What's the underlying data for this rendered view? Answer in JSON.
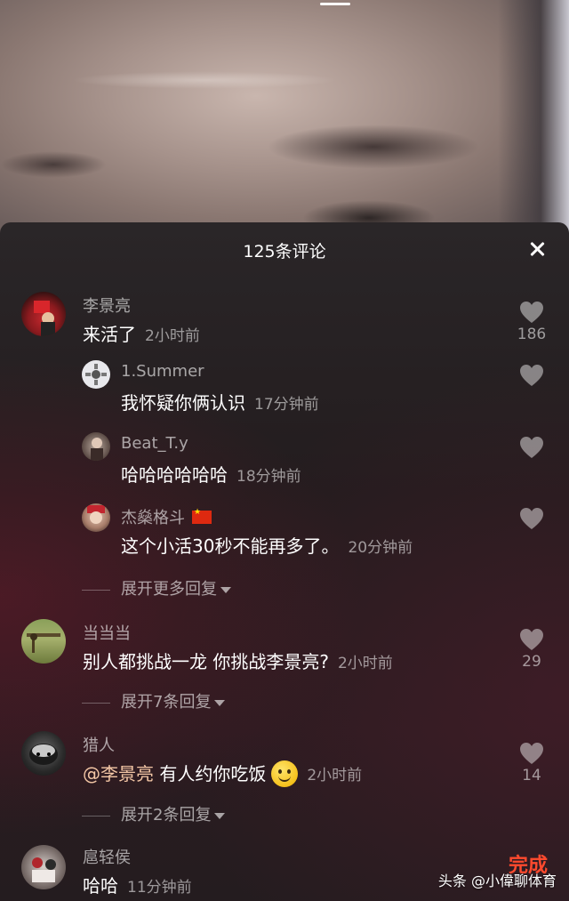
{
  "sheet": {
    "title": "125条评论"
  },
  "comments": [
    {
      "username": "李景亮",
      "text": "来活了",
      "time": "2小时前",
      "likes": "186",
      "replies": [
        {
          "username": "1.Summer",
          "text": "我怀疑你俩认识",
          "time": "17分钟前"
        },
        {
          "username": "Beat_T.y",
          "text": "哈哈哈哈哈哈",
          "time": "18分钟前"
        },
        {
          "username": "杰燊格斗",
          "text": "这个小活30秒不能再多了。",
          "time": "20分钟前",
          "flag": "china-flag-icon"
        }
      ],
      "expand_label": "展开更多回复"
    },
    {
      "username": "当当当",
      "text": "别人都挑战一龙 你挑战李景亮?",
      "time": "2小时前",
      "likes": "29",
      "expand_label": "展开7条回复"
    },
    {
      "username": "猎人",
      "mention": "@李景亮",
      "text": "有人约你吃饭",
      "emoji": "smiling-face-icon",
      "time": "2小时前",
      "likes": "14",
      "expand_label": "展开2条回复"
    },
    {
      "username": "扈轻侯",
      "text": "哈哈",
      "time": "11分钟前"
    }
  ],
  "done_label": "完成",
  "watermark": "头条 @小偉聊体育",
  "colors": {
    "accent": "#ff4a2e",
    "mention": "#f4c7a6",
    "sheet_bg": "#231c1e"
  }
}
